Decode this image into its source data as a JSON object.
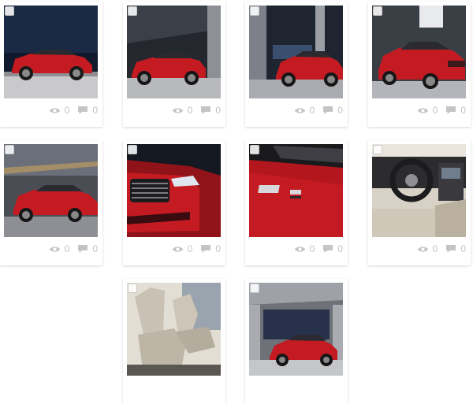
{
  "gallery": {
    "items": [
      {
        "scene": "exterior-night-side",
        "views": "0",
        "comments": "0"
      },
      {
        "scene": "exterior-garage-left",
        "views": "0",
        "comments": "0"
      },
      {
        "scene": "exterior-garage-right",
        "views": "0",
        "comments": "0"
      },
      {
        "scene": "exterior-front-three-quarter",
        "views": "0",
        "comments": "0"
      },
      {
        "scene": "exterior-motion-side",
        "views": "0",
        "comments": "0"
      },
      {
        "scene": "headlight-detail",
        "views": "0",
        "comments": "0"
      },
      {
        "scene": "badge-detail",
        "views": "0",
        "comments": "0"
      },
      {
        "scene": "interior-dashboard",
        "views": "0",
        "comments": "0"
      },
      {
        "scene": "interior-front-seats",
        "views": "",
        "comments": ""
      },
      {
        "scene": "exterior-parking-structure",
        "views": "",
        "comments": ""
      }
    ]
  },
  "colors": {
    "car_red": "#c41b22",
    "stat_gray": "#c4c4c4",
    "card_bg": "#ffffff"
  },
  "icons": {
    "views": "eye-icon",
    "comments": "speech-bubble-icon",
    "select": "checkbox"
  }
}
